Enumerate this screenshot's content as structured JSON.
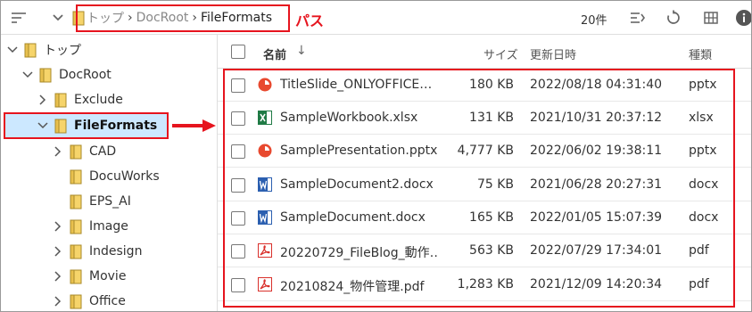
{
  "toolbar": {
    "breadcrumbs": [
      "トップ",
      "DocRoot",
      "FileFormats"
    ],
    "path_annotation": "パス",
    "item_count": "20件"
  },
  "tree": {
    "items": [
      {
        "label": "トップ"
      },
      {
        "label": "DocRoot"
      },
      {
        "label": "Exclude"
      },
      {
        "label": "FileFormats"
      },
      {
        "label": "CAD"
      },
      {
        "label": "DocuWorks"
      },
      {
        "label": "EPS_AI"
      },
      {
        "label": "Image"
      },
      {
        "label": "Indesign"
      },
      {
        "label": "Movie"
      },
      {
        "label": "Office"
      }
    ]
  },
  "list": {
    "headers": {
      "name": "名前",
      "size": "サイズ",
      "date": "更新日時",
      "type": "種類"
    },
    "rows": [
      {
        "icon": "pptx-icon",
        "name": "TitleSlide_ONLYOFFICE…",
        "size": "180 KB",
        "date": "2022/08/18 04:31:40",
        "type": "pptx"
      },
      {
        "icon": "xlsx-icon",
        "name": "SampleWorkbook.xlsx",
        "size": "131 KB",
        "date": "2021/10/31 20:37:12",
        "type": "xlsx"
      },
      {
        "icon": "pptx-icon",
        "name": "SamplePresentation.pptx",
        "size": "4,777 KB",
        "date": "2022/06/02 19:38:11",
        "type": "pptx"
      },
      {
        "icon": "docx-icon",
        "name": "SampleDocument2.docx",
        "size": "75 KB",
        "date": "2021/06/28 20:27:31",
        "type": "docx"
      },
      {
        "icon": "docx-icon",
        "name": "SampleDocument.docx",
        "size": "165 KB",
        "date": "2022/01/05 15:07:39",
        "type": "docx"
      },
      {
        "icon": "pdf-icon",
        "name": "20220729_FileBlog_動作…",
        "size": "563 KB",
        "date": "2022/07/29 17:34:01",
        "type": "pdf"
      },
      {
        "icon": "pdf-icon",
        "name": "20210824_物件管理.pdf",
        "size": "1,283 KB",
        "date": "2021/12/09 14:20:34",
        "type": "pdf"
      }
    ]
  },
  "colors": {
    "annotation_red": "#e6141e",
    "selected_bg": "#cce8ff",
    "folder_yellow": "#f6d46a",
    "pptx_orange": "#e8492f",
    "xlsx_green": "#1f7a45",
    "docx_blue": "#2b5fb0",
    "pdf_red": "#d9302b"
  }
}
